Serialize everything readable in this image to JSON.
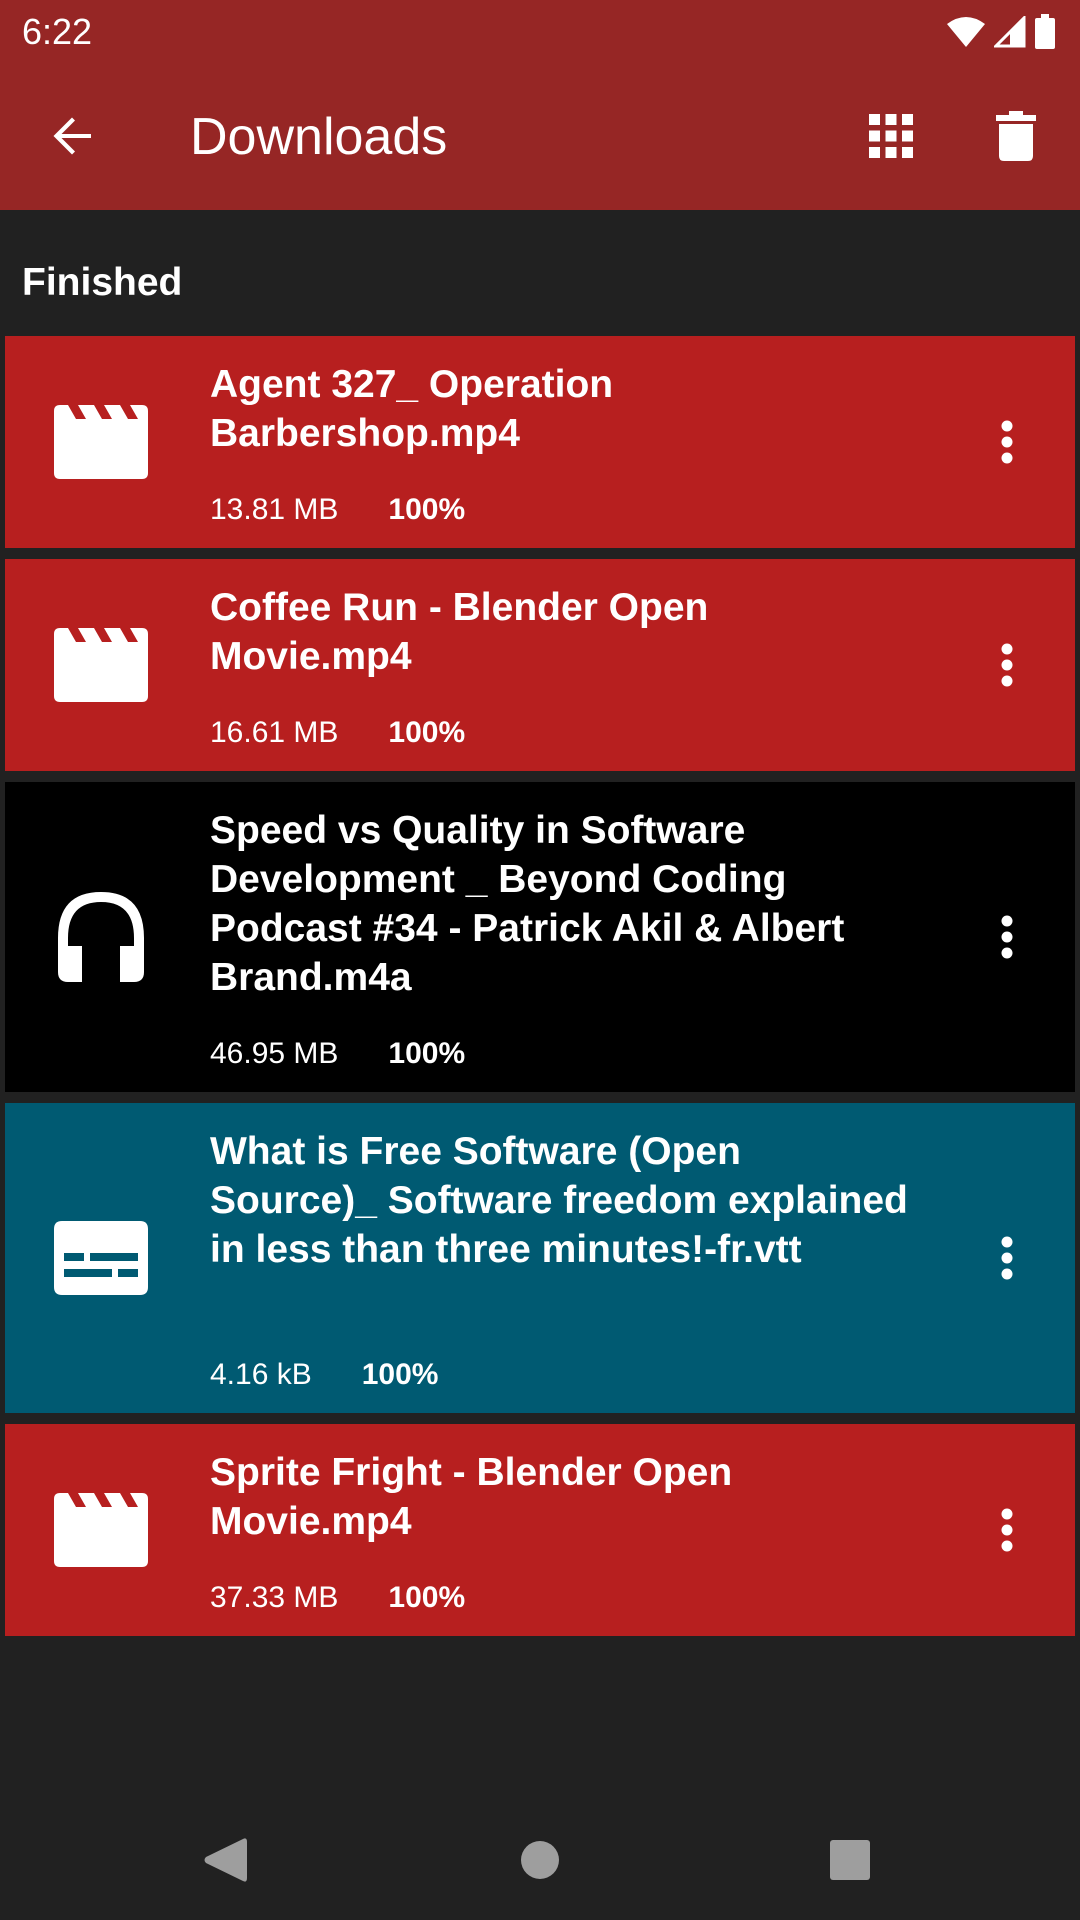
{
  "status_bar": {
    "time": "6:22",
    "icons": [
      "wifi-icon",
      "signal-icon",
      "battery-icon"
    ]
  },
  "app_bar": {
    "title": "Downloads",
    "background": "#962625",
    "actions": [
      "back-arrow-icon",
      "grid-view-icon",
      "delete-icon"
    ]
  },
  "section": {
    "title": "Finished"
  },
  "downloads": [
    {
      "name": "Agent 327_ Operation Barbershop.mp4",
      "size": "13.81 MB",
      "progress": "100%",
      "icon": "video-clapperboard-icon",
      "color": "#B71F1F"
    },
    {
      "name": "Coffee Run - Blender Open Movie.mp4",
      "size": "16.61 MB",
      "progress": "100%",
      "icon": "video-clapperboard-icon",
      "color": "#B71F1F"
    },
    {
      "name": "Speed vs Quality in Software Development _ Beyond Coding Podcast #34 - Patrick Akil & Albert Brand.m4a",
      "size": "46.95 MB",
      "progress": "100%",
      "icon": "headphones-icon",
      "color": "#000000"
    },
    {
      "name": "What is Free Software (Open Source)_ Software freedom explained in less than three minutes!-fr.vtt",
      "size": "4.16 kB",
      "progress": "100%",
      "icon": "subtitles-icon",
      "color": "#005A72"
    },
    {
      "name": "Sprite Fright - Blender Open Movie.mp4",
      "size": "37.33 MB",
      "progress": "100%",
      "icon": "video-clapperboard-icon",
      "color": "#B71F1F"
    }
  ],
  "nav_bar": {
    "buttons": [
      "back-triangle-icon",
      "home-circle-icon",
      "recents-square-icon"
    ]
  }
}
